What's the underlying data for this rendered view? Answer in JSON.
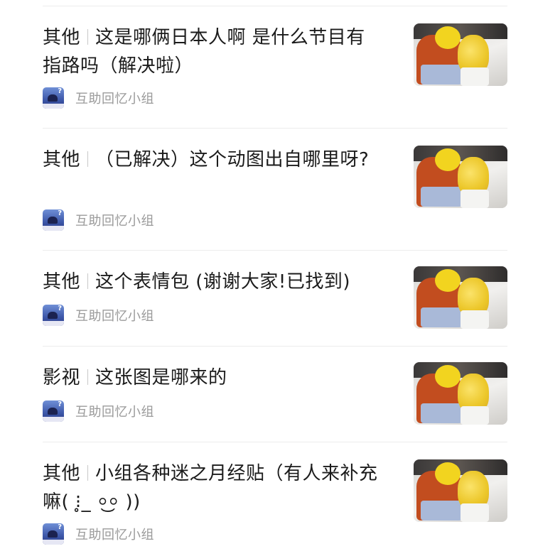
{
  "posts": [
    {
      "category": "其他",
      "title": "这是哪俩日本人啊 是什么节目有指路吗（解决啦）",
      "group_name": "互助回忆小组",
      "avatar_icon": "group-avatar-icon",
      "thumbnail_icon": "post-thumbnail"
    },
    {
      "category": "其他",
      "title": "（已解决）这个动图出自哪里呀?",
      "group_name": "互助回忆小组",
      "avatar_icon": "group-avatar-icon",
      "thumbnail_icon": "post-thumbnail"
    },
    {
      "category": "其他",
      "title": "这个表情包 (谢谢大家!已找到)",
      "group_name": "互助回忆小组",
      "avatar_icon": "group-avatar-icon",
      "thumbnail_icon": "post-thumbnail"
    },
    {
      "category": "影视",
      "title": "这张图是哪来的",
      "group_name": "互助回忆小组",
      "avatar_icon": "group-avatar-icon",
      "thumbnail_icon": "post-thumbnail"
    },
    {
      "category": "其他",
      "title": "小组各种迷之月经贴（有人来补充嘛( ⁝̥_ ⸰͜⸰ ))",
      "group_name": "互助回忆小组",
      "avatar_icon": "group-avatar-icon",
      "thumbnail_icon": "post-thumbnail"
    }
  ],
  "avatar_mark": "?",
  "colors": {
    "title_text": "#1b1b1b",
    "meta_text": "#9a9a9a",
    "divider": "#ececec",
    "avatar_blue": "#3c56a8",
    "thumb_yellow": "#f2d41f",
    "thumb_orange": "#c24d1f"
  }
}
